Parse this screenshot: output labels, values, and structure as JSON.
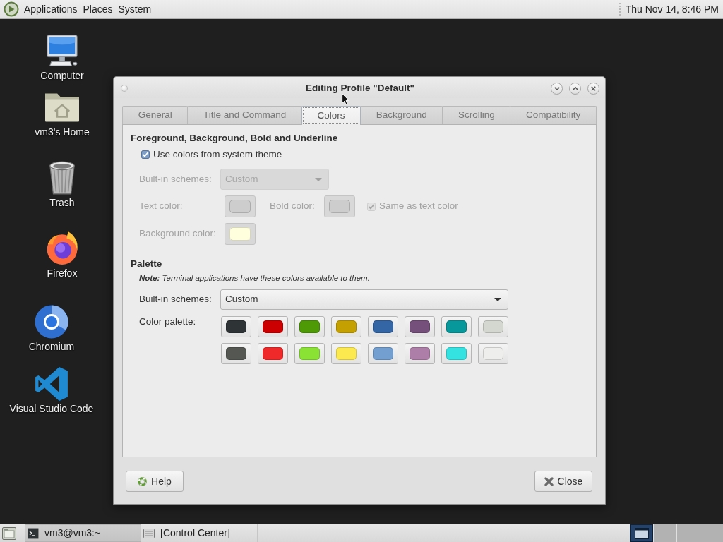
{
  "top_panel": {
    "menus": [
      "Applications",
      "Places",
      "System"
    ],
    "clock": "Thu Nov 14, 8:46 PM"
  },
  "desktop_icons": [
    {
      "kind": "computer",
      "label": "Computer"
    },
    {
      "kind": "home",
      "label": "vm3's Home"
    },
    {
      "kind": "trash",
      "label": "Trash"
    },
    {
      "kind": "firefox",
      "label": "Firefox"
    },
    {
      "kind": "chromium",
      "label": "Chromium"
    },
    {
      "kind": "vscode",
      "label": "Visual Studio Code"
    }
  ],
  "dialog": {
    "title": "Editing Profile \"Default\"",
    "tabs": [
      {
        "label": "General",
        "selected": false
      },
      {
        "label": "Title and Command",
        "selected": false
      },
      {
        "label": "Colors",
        "selected": true
      },
      {
        "label": "Background",
        "selected": false
      },
      {
        "label": "Scrolling",
        "selected": false
      },
      {
        "label": "Compatibility",
        "selected": false
      }
    ],
    "foreground_section": {
      "heading": "Foreground, Background, Bold and Underline",
      "use_system_colors": {
        "label": "Use colors from system theme",
        "checked": true
      },
      "builtin_schemes": {
        "label": "Built-in schemes:",
        "value": "Custom",
        "disabled": true
      },
      "text_color": {
        "label": "Text color:",
        "color": "#cdcdcd",
        "disabled": true
      },
      "bold_color": {
        "label": "Bold color:",
        "color": "#cdcdcd",
        "disabled": true
      },
      "same_as_text": {
        "label": "Same as text color",
        "checked": true,
        "disabled": true
      },
      "background_color": {
        "label": "Background color:",
        "color": "#ffffdd",
        "disabled": true
      }
    },
    "palette_section": {
      "heading": "Palette",
      "note": "**Note:** Terminal applications have these colors available to them.",
      "builtin_schemes": {
        "label": "Built-in schemes:",
        "value": "Custom",
        "disabled": false
      },
      "palette_label": "Color palette:",
      "colors": [
        {
          "color": "#2e3436"
        },
        {
          "color": "#cc0000"
        },
        {
          "color": "#4e9a06"
        },
        {
          "color": "#c4a000"
        },
        {
          "color": "#3465a4"
        },
        {
          "color": "#75507b"
        },
        {
          "color": "#06989a"
        },
        {
          "color": "#d3d7cf"
        },
        {
          "color": "#555753"
        },
        {
          "color": "#ef2929"
        },
        {
          "color": "#8ae234"
        },
        {
          "color": "#fce94f"
        },
        {
          "color": "#729fcf"
        },
        {
          "color": "#ad7fa8"
        },
        {
          "color": "#34e2e2"
        },
        {
          "color": "#eeeeec"
        }
      ]
    },
    "buttons": [
      {
        "kind": "help",
        "label": "Help"
      },
      {
        "kind": "close",
        "label": "Close"
      }
    ]
  },
  "taskbar": {
    "tasks": [
      {
        "kind": "terminal",
        "label": "vm3@vm3:~",
        "selected": true
      },
      {
        "kind": "settings",
        "label": "[Control Center]",
        "selected": false
      }
    ],
    "workspaces": [
      {
        "selected": true
      },
      {
        "selected": false
      },
      {
        "selected": false
      },
      {
        "selected": false
      }
    ]
  }
}
